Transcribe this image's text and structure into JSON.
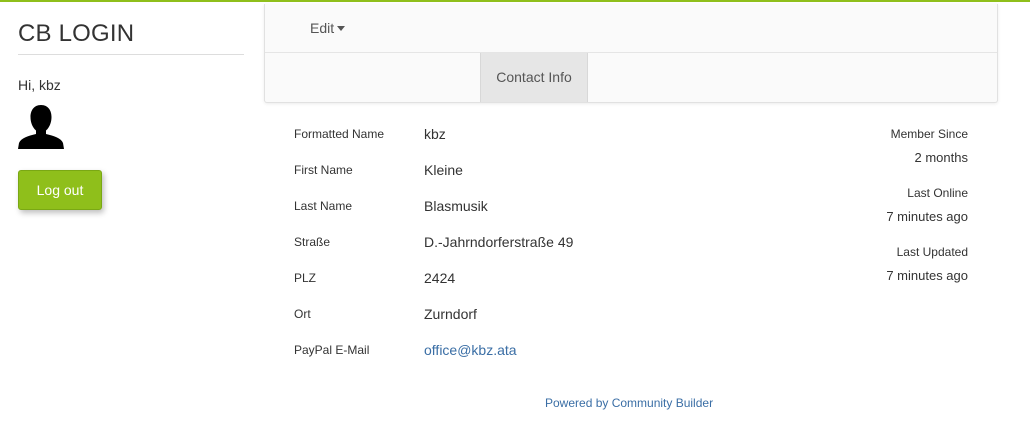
{
  "login_module": {
    "title": "CB LOGIN",
    "greeting": "Hi, kbz",
    "avatar_icon": "user-silhouette-icon",
    "logout_label": "Log out"
  },
  "profile_tabs": {
    "edit_label": "Edit",
    "edit_icon": "caret-down-icon",
    "tabs": [
      {
        "label": "Contact Info",
        "active": true
      }
    ]
  },
  "profile_fields": [
    {
      "label": "Formatted Name",
      "value": "kbz"
    },
    {
      "label": "First Name",
      "value": "Kleine"
    },
    {
      "label": "Last Name",
      "value": "Blasmusik"
    },
    {
      "label": "Straße",
      "value": "D.-Jahrndorferstraße 49"
    },
    {
      "label": "PLZ",
      "value": "2424"
    },
    {
      "label": "Ort",
      "value": "Zurndorf"
    },
    {
      "label": "PayPal E-Mail",
      "value": "office@kbz.ata"
    }
  ],
  "status": {
    "member_since_label": "Member Since",
    "member_since_value": "2 months",
    "last_online_label": "Last Online",
    "last_online_value": "7 minutes ago",
    "last_updated_label": "Last Updated",
    "last_updated_value": "7 minutes ago"
  },
  "footer": {
    "powered_by": "Powered by Community Builder"
  },
  "colors": {
    "accent_green": "#8fbf1b",
    "link_blue": "#3a6ea5",
    "tab_active_bg": "#e6e6e6"
  }
}
